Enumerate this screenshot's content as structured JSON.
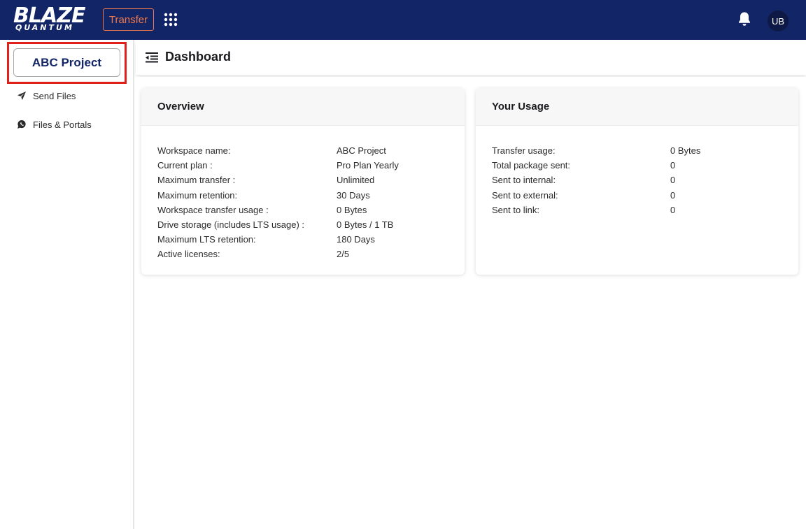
{
  "header": {
    "logo_main": "BLAZE",
    "logo_sub": "QUANTUM",
    "transfer_label": "Transfer",
    "avatar_initials": "UB",
    "colors": {
      "bar": "#122567",
      "accent": "#f0784a"
    }
  },
  "sidebar": {
    "project_label": "ABC Project",
    "items": [
      {
        "label": "Send Files",
        "icon": "send-icon"
      },
      {
        "label": "Files & Portals",
        "icon": "chat-icon"
      }
    ]
  },
  "main": {
    "title": "Dashboard"
  },
  "overview": {
    "title": "Overview",
    "rows": [
      {
        "label": "Workspace name:",
        "value": "ABC Project"
      },
      {
        "label": "Current plan :",
        "value": "Pro Plan Yearly"
      },
      {
        "label": "Maximum transfer :",
        "value": "Unlimited"
      },
      {
        "label": "Maximum retention:",
        "value": "30 Days"
      },
      {
        "label": "Workspace transfer usage :",
        "value": "0 Bytes"
      },
      {
        "label": "Drive storage (includes LTS usage) :",
        "value": "0 Bytes / 1 TB"
      },
      {
        "label": "Maximum LTS retention:",
        "value": "180 Days"
      },
      {
        "label": "Active licenses:",
        "value": "2/5"
      }
    ]
  },
  "usage": {
    "title": "Your Usage",
    "rows": [
      {
        "label": "Transfer usage:",
        "value": "0 Bytes"
      },
      {
        "label": "Total package sent:",
        "value": "0"
      },
      {
        "label": "Sent to internal:",
        "value": "0"
      },
      {
        "label": "Sent to external:",
        "value": "0"
      },
      {
        "label": "Sent to link:",
        "value": "0"
      }
    ]
  }
}
